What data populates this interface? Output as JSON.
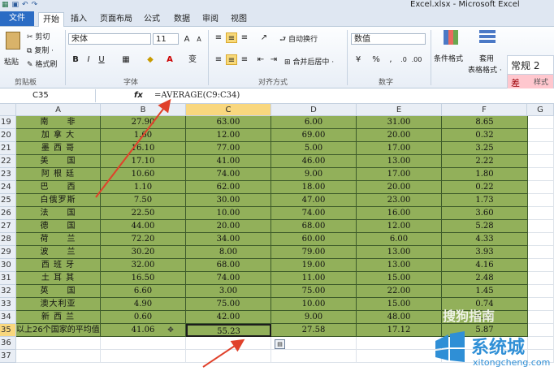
{
  "window": {
    "title": "Excel.xlsx - Microsoft Excel"
  },
  "tabs": [
    "文件",
    "开始",
    "插入",
    "页面布局",
    "公式",
    "数据",
    "审阅",
    "视图"
  ],
  "ribbon": {
    "paste_label": "粘贴",
    "cut_label": "剪切",
    "copy_label": "复制 ·",
    "format_painter_label": "格式刷",
    "clipboard_group": "剪贴板",
    "font_name": "宋体",
    "font_size": "11",
    "font_group": "字体",
    "wrap_label": "自动换行",
    "merge_label": "合并后居中 ·",
    "alignment_group": "对齐方式",
    "number_format": "数值",
    "number_group": "数字",
    "conditional_label": "条件格式",
    "table_label_1": "套用",
    "table_label_2": "表格格式 ·",
    "styles_group": "样式",
    "style_normal": "常规 2",
    "style_bad": "差"
  },
  "formula_bar": {
    "name_box": "C35",
    "fx": "fx",
    "formula": "=AVERAGE(C9:C34)"
  },
  "columns": [
    "A",
    "B",
    "C",
    "D",
    "E",
    "F",
    "G"
  ],
  "rows": [
    {
      "n": "19",
      "a": "南　　非",
      "b": "27.90",
      "c": "63.00",
      "d": "6.00",
      "e": "31.00",
      "f": "8.65"
    },
    {
      "n": "20",
      "a": "加 拿 大",
      "b": "1.60",
      "c": "12.00",
      "d": "69.00",
      "e": "20.00",
      "f": "0.32"
    },
    {
      "n": "21",
      "a": "墨 西 哥",
      "b": "16.10",
      "c": "77.00",
      "d": "5.00",
      "e": "17.00",
      "f": "3.25"
    },
    {
      "n": "22",
      "a": "美　　国",
      "b": "17.10",
      "c": "41.00",
      "d": "46.00",
      "e": "13.00",
      "f": "2.22"
    },
    {
      "n": "23",
      "a": "阿 根 廷",
      "b": "10.60",
      "c": "74.00",
      "d": "9.00",
      "e": "17.00",
      "f": "1.80"
    },
    {
      "n": "24",
      "a": "巴　　西",
      "b": "1.10",
      "c": "62.00",
      "d": "18.00",
      "e": "20.00",
      "f": "0.22"
    },
    {
      "n": "25",
      "a": "白俄罗斯",
      "b": "7.50",
      "c": "30.00",
      "d": "47.00",
      "e": "23.00",
      "f": "1.73"
    },
    {
      "n": "26",
      "a": "法　　国",
      "b": "22.50",
      "c": "10.00",
      "d": "74.00",
      "e": "16.00",
      "f": "3.60"
    },
    {
      "n": "27",
      "a": "德　　国",
      "b": "44.00",
      "c": "20.00",
      "d": "68.00",
      "e": "12.00",
      "f": "5.28"
    },
    {
      "n": "28",
      "a": "荷　　兰",
      "b": "72.20",
      "c": "34.00",
      "d": "60.00",
      "e": "6.00",
      "f": "4.33"
    },
    {
      "n": "29",
      "a": "波　　兰",
      "b": "30.20",
      "c": "8.00",
      "d": "79.00",
      "e": "13.00",
      "f": "3.93"
    },
    {
      "n": "30",
      "a": "西 班 牙",
      "b": "32.00",
      "c": "68.00",
      "d": "19.00",
      "e": "13.00",
      "f": "4.16"
    },
    {
      "n": "31",
      "a": "土 耳 其",
      "b": "16.50",
      "c": "74.00",
      "d": "11.00",
      "e": "15.00",
      "f": "2.48"
    },
    {
      "n": "32",
      "a": "英　　国",
      "b": "6.60",
      "c": "3.00",
      "d": "75.00",
      "e": "22.00",
      "f": "1.45"
    },
    {
      "n": "33",
      "a": "澳大利亚",
      "b": "4.90",
      "c": "75.00",
      "d": "10.00",
      "e": "15.00",
      "f": "0.74"
    },
    {
      "n": "34",
      "a": "新 西 兰",
      "b": "0.60",
      "c": "42.00",
      "d": "9.00",
      "e": "48.00",
      "f": "0.29"
    },
    {
      "n": "35",
      "a": "以上26个国家的平均值",
      "b": "41.06",
      "c": "55.23",
      "d": "27.58",
      "e": "17.12",
      "f": "5.87"
    },
    {
      "n": "36",
      "a": "",
      "b": "",
      "c": "",
      "d": "",
      "e": "",
      "f": ""
    },
    {
      "n": "37",
      "a": "",
      "b": "",
      "c": "",
      "d": "",
      "e": "",
      "f": ""
    }
  ],
  "watermarks": {
    "top": "搜狗指南",
    "brand": "系统城",
    "url": "xitongcheng.com"
  },
  "colors": {
    "cell_fill": "#92b05a",
    "selected_header": "#f9d77e",
    "arrow": "#e0412b",
    "file_tab": "#2b6cc4"
  }
}
